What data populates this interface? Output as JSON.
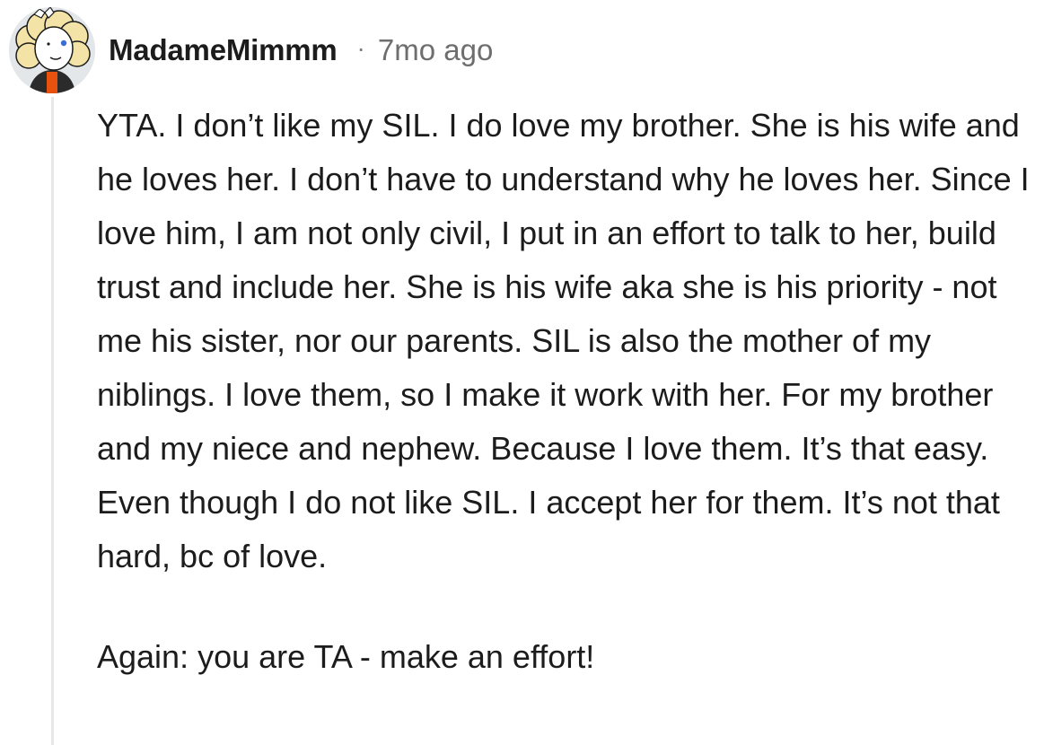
{
  "comment": {
    "author": "MadameMimmm",
    "separator": "·",
    "time_ago": "7mo ago",
    "avatar_icon": "snoo-avatar-icon",
    "paragraphs": [
      "YTA. I don’t like my SIL. I do love my brother. She is his wife and he loves her. I don’t have to understand why he loves her. Since I love him, I am not only civil, I put in an effort to talk to her, build trust and include her. She is his wife aka she is his priority - not me his sister, nor our parents. SIL is also the mother of my niblings. I love them, so I make it work with her. For my brother and my niece and nephew. Because I love them. It’s that easy. Even though I do not like SIL. I accept her for them. It’s not that hard, bc of love.",
      "Again: you are TA - make an effort!"
    ]
  },
  "colors": {
    "text": "#1c1c1c",
    "meta": "#6e6e6e",
    "thread_line": "#e8e8e8",
    "avatar_hair": "#f3e3a6",
    "avatar_shirt": "#e8520e"
  }
}
